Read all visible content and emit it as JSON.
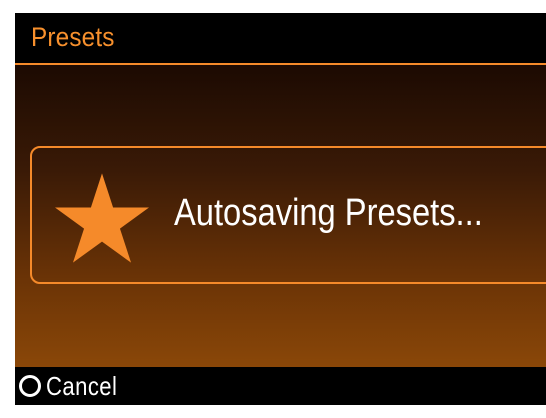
{
  "header": {
    "title": "Presets"
  },
  "dialog": {
    "icon": "star-icon",
    "message": "Autosaving Presets..."
  },
  "footer": {
    "cancel_icon": "circle-icon",
    "cancel_label": "Cancel"
  },
  "colors": {
    "accent": "#f58a2a",
    "background": "#000000",
    "gradient_bottom": "#8a4708",
    "text": "#ffffff"
  }
}
